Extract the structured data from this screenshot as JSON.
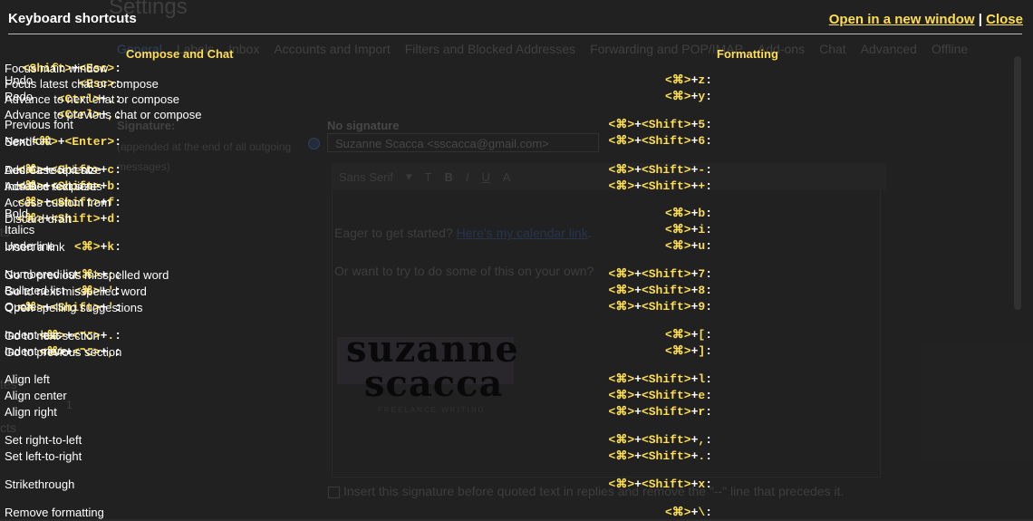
{
  "background": {
    "settings_title": "Settings",
    "tabs": [
      "General",
      "Labels",
      "Inbox",
      "Accounts and Import",
      "Filters and Blocked Addresses",
      "Forwarding and POP/IMAP",
      "Add-ons",
      "Chat",
      "Advanced",
      "Offline"
    ],
    "left_fragments": [
      "ts",
      "tes",
      "1",
      "cts"
    ],
    "signature_label": "Signature:",
    "signature_desc": "(appended at the end of all outgoing messages)",
    "no_signature": "No signature",
    "signature_select": "Suzanne Scacca <sscacca@gmail.com>",
    "font_select": "Sans Serif",
    "editor_line1": "Eager to get started?",
    "editor_link": "Here's my calendar link",
    "editor_line2": "Or want to try to do some of this on your own?",
    "logo_line1": "suzanne",
    "logo_line2": "scacca",
    "logo_line3": "FREELANCE WRITING",
    "checkbox_text": "Insert this signature before quoted text in replies and remove the \"--\" line that precedes it."
  },
  "overlay": {
    "title": "Keyboard shortcuts",
    "open_new_window": "Open in a new window",
    "separator": "|",
    "close": "Close",
    "compose_heading": "Compose and Chat",
    "formatting_heading": "Formatting",
    "compose_shortcuts": [
      {
        "keys": [
          "<Shift>",
          "<Esc>"
        ],
        "desc": "Focus main window"
      },
      {
        "keys": [
          "<Esc>"
        ],
        "desc": "Focus latest chat or compose"
      },
      {
        "keys": [
          "<Ctrl>",
          "."
        ],
        "desc": "Advance to next chat or compose"
      },
      {
        "keys": [
          "<Ctrl>",
          ","
        ],
        "desc": "Advance to previous chat or compose"
      },
      {
        "keys": [
          "<⌘>",
          "<Enter>"
        ],
        "desc": "Send"
      },
      {
        "keys": [
          "<⌘>",
          "<Shift>",
          "c"
        ],
        "desc": "Add Cc recipients"
      },
      {
        "keys": [
          "<⌘>",
          "<Shift>",
          "b"
        ],
        "desc": "Add Bcc recipients"
      },
      {
        "keys": [
          "<⌘>",
          "<Shift>",
          "f"
        ],
        "desc": "Access custom from"
      },
      {
        "keys": [
          "<⌘>",
          "<Shift>",
          "d"
        ],
        "desc": "Discard draft"
      },
      {
        "keys": [
          "<⌘>",
          "k"
        ],
        "desc": "Insert a link"
      },
      {
        "keys": [
          "<⌘>",
          ";"
        ],
        "desc": "Go to previous misspelled word"
      },
      {
        "keys": [
          "<⌘>",
          "'"
        ],
        "desc": "Go to next misspelled word"
      },
      {
        "keys": [
          "<⌘>",
          "<Shift>",
          "'"
        ],
        "desc": "Open spelling suggestions"
      },
      {
        "keys": [
          "<⌘>",
          "<⌥>",
          "."
        ],
        "desc": "Go to next section"
      },
      {
        "keys": [
          "<⌘>",
          "<⌥>",
          ","
        ],
        "desc": "Go to previous section"
      }
    ],
    "formatting_shortcuts": [
      {
        "keys": [
          "<⌘>",
          "z"
        ],
        "desc": "Undo"
      },
      {
        "keys": [
          "<⌘>",
          "y"
        ],
        "desc": "Redo"
      },
      {
        "keys": [
          "<⌘>",
          "<Shift>",
          "5"
        ],
        "desc": "Previous font"
      },
      {
        "keys": [
          "<⌘>",
          "<Shift>",
          "6"
        ],
        "desc": "Next font"
      },
      {
        "keys": [
          "<⌘>",
          "<Shift>",
          "-"
        ],
        "desc": "Decrease text size"
      },
      {
        "keys": [
          "<⌘>",
          "<Shift>",
          "+"
        ],
        "desc": "Increase text size"
      },
      {
        "keys": [
          "<⌘>",
          "b"
        ],
        "desc": "Bold"
      },
      {
        "keys": [
          "<⌘>",
          "i"
        ],
        "desc": "Italics"
      },
      {
        "keys": [
          "<⌘>",
          "u"
        ],
        "desc": "Underline"
      },
      {
        "keys": [
          "<⌘>",
          "<Shift>",
          "7"
        ],
        "desc": "Numbered list"
      },
      {
        "keys": [
          "<⌘>",
          "<Shift>",
          "8"
        ],
        "desc": "Bulleted list"
      },
      {
        "keys": [
          "<⌘>",
          "<Shift>",
          "9"
        ],
        "desc": "Quote"
      },
      {
        "keys": [
          "<⌘>",
          "["
        ],
        "desc": "Indent less"
      },
      {
        "keys": [
          "<⌘>",
          "]"
        ],
        "desc": "Indent more"
      },
      {
        "keys": [
          "<⌘>",
          "<Shift>",
          "l"
        ],
        "desc": "Align left"
      },
      {
        "keys": [
          "<⌘>",
          "<Shift>",
          "e"
        ],
        "desc": "Align center"
      },
      {
        "keys": [
          "<⌘>",
          "<Shift>",
          "r"
        ],
        "desc": "Align right"
      },
      {
        "keys": [
          "<⌘>",
          "<Shift>",
          ","
        ],
        "desc": "Set right-to-left"
      },
      {
        "keys": [
          "<⌘>",
          "<Shift>",
          "."
        ],
        "desc": "Set left-to-right"
      },
      {
        "keys": [
          "<⌘>",
          "<Shift>",
          "x"
        ],
        "desc": "Strikethrough"
      },
      {
        "keys": [
          "<⌘>",
          "\\"
        ],
        "desc": "Remove formatting"
      }
    ],
    "accent_color": "#fede53"
  }
}
